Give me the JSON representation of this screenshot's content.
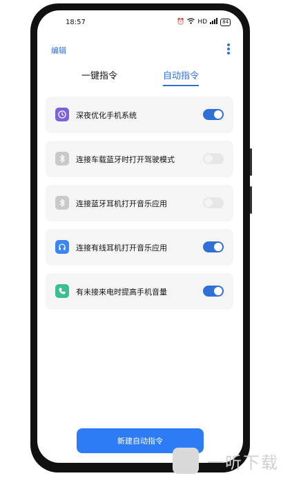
{
  "status": {
    "time": "18:57",
    "battery": "84",
    "network": "HD"
  },
  "header": {
    "edit_label": "编辑"
  },
  "tabs": [
    {
      "label": "一键指令",
      "active": false
    },
    {
      "label": "自动指令",
      "active": true
    }
  ],
  "items": [
    {
      "label": "深夜优化手机系统",
      "icon": "clock-icon",
      "icon_color": "#7b62d8",
      "enabled": true
    },
    {
      "label": "连接车载蓝牙时打开驾驶模式",
      "icon": "bluetooth-icon",
      "icon_color": "#c9c9cc",
      "enabled": false
    },
    {
      "label": "连接蓝牙耳机打开音乐应用",
      "icon": "bluetooth-icon",
      "icon_color": "#c9c9cc",
      "enabled": false
    },
    {
      "label": "连接有线耳机打开音乐应用",
      "icon": "headphones-icon",
      "icon_color": "#3b86f0",
      "enabled": true
    },
    {
      "label": "有未接来电时提高手机音量",
      "icon": "phone-icon",
      "icon_color": "#3bbf8e",
      "enabled": true
    }
  ],
  "footer": {
    "new_button_label": "新建自动指令"
  },
  "watermark": {
    "text": "一听下载"
  },
  "colors": {
    "accent": "#2f6fd6",
    "button": "#2d7cf6"
  }
}
